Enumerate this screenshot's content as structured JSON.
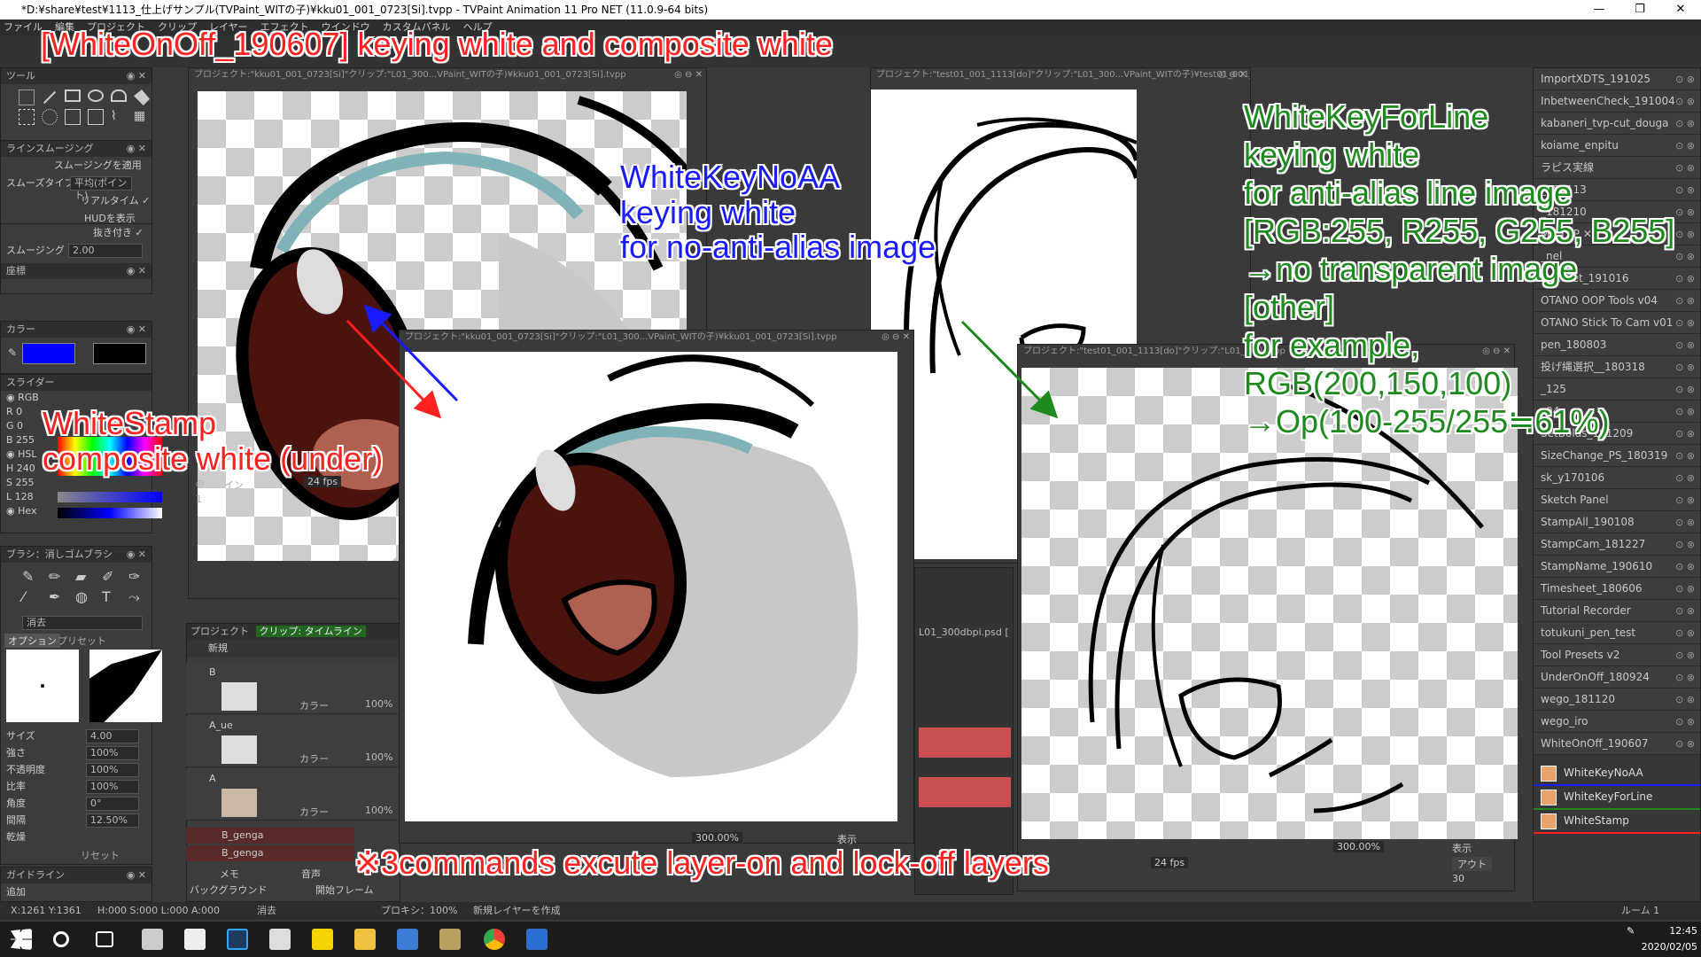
{
  "window": {
    "title": "*D:¥share¥test¥1113_仕上げサンプル(TVPaint_WITの子)¥kku01_001_0723[Si].tvpp - TVPaint Animation 11 Pro NET (11.0.9-64 bits)",
    "min": "—",
    "max": "❐",
    "close": "✕"
  },
  "menu": [
    "ファイル",
    "編集",
    "プロジェクト",
    "クリップ",
    "レイヤー",
    "エフェクト",
    "ウインドウ",
    "カスタムパネル",
    "ヘルプ"
  ],
  "left_panels": {
    "tools_title": "ツール",
    "smoothing_title": "ラインスムージング",
    "smoothing_apply": "スムージングを適用",
    "smooth_type_label": "スムーズタイプ",
    "smooth_type_value": "平均(ポイント)",
    "realtime": "リアルタイム",
    "hud": "HUDを表示",
    "pull": "抜き付き",
    "smoothing_label": "スムージング",
    "smoothing_value": "2.00",
    "coords_title": "座標",
    "color_title": "カラー",
    "slider_title": "スライダー",
    "rgb_label": "RGB",
    "r": "R",
    "r_val": "0",
    "g": "G",
    "g_val": "0",
    "b": "B",
    "b_val": "255",
    "hsl": "HSL",
    "h": "H",
    "h_val": "240",
    "s": "S",
    "s_val": "255",
    "l": "L",
    "l_val": "128",
    "hex": "Hex",
    "brush_title": "ブラシ：消しゴムブラシ",
    "erase": "消去",
    "option_tab": "オプション",
    "preset_tab": "プリセット",
    "size_label": "サイズ",
    "size_val": "4.00",
    "strength_label": "強さ",
    "strength_val": "100%",
    "opacity_label": "不透明度",
    "opacity_val": "100%",
    "ratio_label": "比率",
    "ratio_val": "100%",
    "angle_label": "角度",
    "angle_val": "0°",
    "spacing_label": "間隔",
    "spacing_val": "12.50%",
    "dry_label": "乾燥",
    "reset": "リセット",
    "guide_title": "ガイドライン",
    "add": "追加"
  },
  "windows": {
    "w1_title": "プロジェクト:\"kku01_001_0723[Si]\"クリップ:\"L01_300...VPaint_WITの子)¥kku01_001_0723[Si].tvpp",
    "w2_title": "プロジェクト:\"test01_001_1113[do]\"クリップ:\"L01_300...VPaint_WITの子)¥test01_001_1113[do].tvpp",
    "w3_title": "プロジェクト:\"kku01_001_0723[Si]\"クリップ:\"L01_300...VPaint_WITの子)¥kku01_001_0723[Si].tvpp",
    "w4_title": "プロジェクト:\"test01_001_1113[do]\"クリップ:\"L01_3",
    "w4_title_end": "o].tvpp",
    "zoom1": "300.00%",
    "zoom2": "300.00%",
    "display": "表示",
    "fps1": "24 fps",
    "fps2": "24 fps",
    "in_label": "イン",
    "out_label": "アウト",
    "frame_1": "1",
    "frame_30": "30",
    "psd": "L01_300dbpi.psd ["
  },
  "timeline": {
    "tab1": "プロジェクト",
    "tab2": "クリップ: タイムライン",
    "new": "新規",
    "layers": [
      {
        "name": "B",
        "mode": "カラー",
        "opacity": "100%"
      },
      {
        "name": "A_ue",
        "mode": "カラー",
        "opacity": "100%"
      },
      {
        "name": "A",
        "mode": "カラー",
        "opacity": "100%"
      }
    ],
    "genga1": "B_genga",
    "genga2": "B_genga",
    "memo": "メモ",
    "sound": "音声",
    "background": "バックグラウンド",
    "start_frame": "開始フレーム"
  },
  "plugins": [
    "ImportXDTS_191025",
    "InbetweenCheck_191004",
    "kabaneri_tvp-cut_douga",
    "koiame_enpitu",
    "ラピス実線",
    "_181113",
    "_181210",
    "My TVP ✕",
    "_nel",
    "NextSet_191016",
    "OTANO OOP Tools v04",
    "OTANO Stick To Cam v01",
    "pen_180803",
    "投げ縄選択__180318",
    "_125",
    "_04",
    "SetBolds_191209",
    "SizeChange_PS_180319",
    "sk_y170106",
    "Sketch Panel",
    "StampAll_190108",
    "StampCam_181227",
    "StampName_190610",
    "Timesheet_180606",
    "Tutorial Recorder",
    "totukuni_pen_test",
    "Tool Presets v2",
    "UnderOnOff_180924",
    "wego_181120",
    "wego_iro",
    "WhiteOnOff_190607"
  ],
  "commands": [
    {
      "label": "WhiteKeyNoAA",
      "color": "#1a1aff"
    },
    {
      "label": "WhiteKeyForLine",
      "color": "#1e8a1e"
    },
    {
      "label": "WhiteStamp",
      "color": "#ff2020"
    }
  ],
  "status": {
    "coords": "X:1261 Y:1361",
    "hsl": "H:000 S:000 L:000 A:000",
    "erase": "消去",
    "proxy": "プロキシ：100%",
    "new_layer": "新規レイヤーを作成",
    "room": "ルーム 1"
  },
  "annotations": {
    "title": "[WhiteOnOff_190607]  keying white and composite white",
    "noaa_1": "WhiteKeyNoAA",
    "noaa_2": "keying white",
    "noaa_3": "for no-anti-alias image",
    "stamp_1": "WhiteStamp",
    "stamp_2": "composite white (under)",
    "line_1": "WhiteKeyForLine",
    "line_2": "keying white",
    "line_3": "for anti-alias line image",
    "line_4": "[RGB:255, R255, G255, B255]",
    "line_5": "→no transparent image",
    "line_6": "[other]",
    "line_7": "for example,",
    "line_8": "RGB(200,150,100)",
    "line_9": "→Op(100-255/255≒61%)",
    "bottom": "※3commands excute layer-on and lock-off layers"
  },
  "taskbar": {
    "time": "12:45",
    "date": "2020/02/05"
  }
}
